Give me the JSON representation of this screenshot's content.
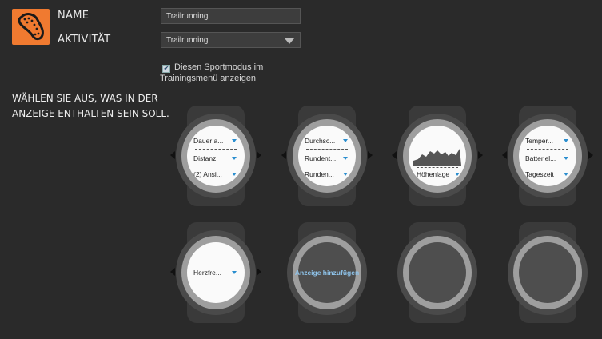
{
  "header": {
    "name_label": "NAME",
    "activity_label": "AKTIVITÄT",
    "name_value": "Trailrunning",
    "activity_value": "Trailrunning",
    "logo_icon": "running-shoe-sole-icon"
  },
  "sport_mode": {
    "checkbox_checked": true,
    "checkbox_label_line1": "Diesen Sportmodus im",
    "checkbox_label_line2": "Trainingsmenü anzeigen"
  },
  "instruction": {
    "line1": "Wählen Sie aus, was in der",
    "line2": "Anzeige enthalten sein soll."
  },
  "watches": [
    {
      "rows": [
        "Dauer a...",
        "Distanz",
        "(2) Ansi..."
      ]
    },
    {
      "rows": [
        "Durchsc...",
        "Rundent...",
        "Runden..."
      ]
    },
    {
      "chart_label": "Höhenlage"
    },
    {
      "rows": [
        "Temper...",
        "Batteriel...",
        "Tageszeit"
      ]
    },
    {
      "rows": [
        "Herzfre..."
      ]
    },
    {
      "add_label": "Anzeige hinzufügen"
    },
    {},
    {}
  ],
  "colors": {
    "accent": "#f07a30",
    "dropdown_blue": "#2a8ecf",
    "background": "#2a2a2a"
  }
}
